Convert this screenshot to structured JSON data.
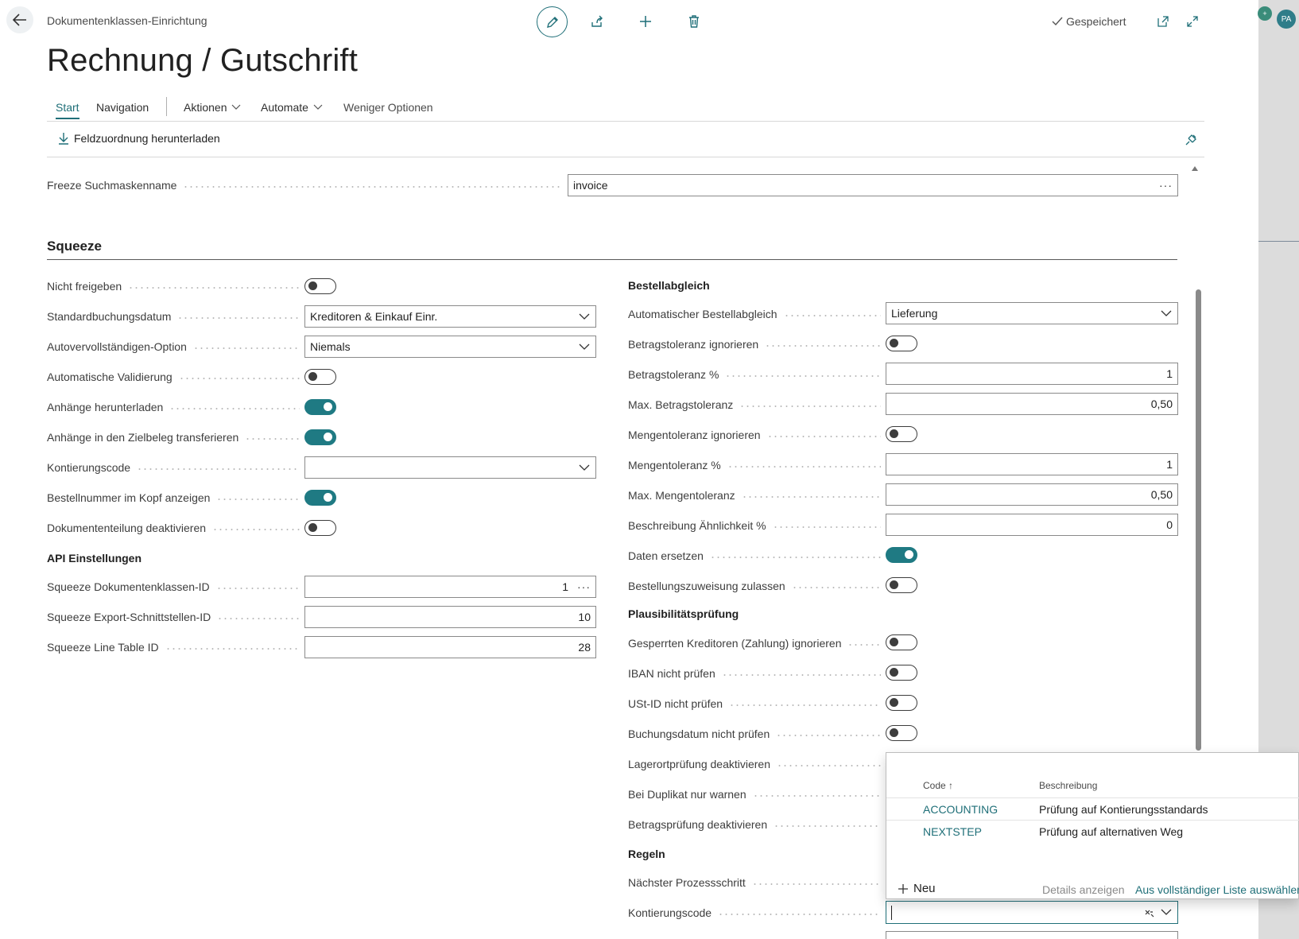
{
  "breadcrumb": "Dokumentenklassen-Einrichtung",
  "title": "Rechnung / Gutschrift",
  "status": {
    "saved": "Gespeichert"
  },
  "user": {
    "initials": "PA"
  },
  "tabs": {
    "start": "Start",
    "navigation": "Navigation",
    "actions": "Aktionen",
    "automate": "Automate",
    "fewer": "Weniger Optionen"
  },
  "promoted": {
    "download": "Feldzuordnung herunterladen"
  },
  "freeze": {
    "label": "Freeze Suchmaskenname",
    "value": "invoice"
  },
  "section": "Squeeze",
  "left": {
    "nicht_freigeben": {
      "label": "Nicht freigeben",
      "on": false
    },
    "standardbuchungsdatum": {
      "label": "Standardbuchungsdatum",
      "value": "Kreditoren & Einkauf Einr."
    },
    "autovervollstaendigen": {
      "label": "Autovervollständigen-Option",
      "value": "Niemals"
    },
    "auto_validierung": {
      "label": "Automatische Validierung",
      "on": false
    },
    "anhaenge_herunterladen": {
      "label": "Anhänge herunterladen",
      "on": true
    },
    "anhaenge_transferieren": {
      "label": "Anhänge in den Zielbeleg transferieren",
      "on": true
    },
    "kontierungscode": {
      "label": "Kontierungscode",
      "value": ""
    },
    "bestellnummer_kopf": {
      "label": "Bestellnummer im Kopf anzeigen",
      "on": true
    },
    "dokumententeilung": {
      "label": "Dokumententeilung deaktivieren",
      "on": false
    },
    "api_title": "API Einstellungen",
    "dokklassen_id": {
      "label": "Squeeze Dokumentenklassen-ID",
      "value": "1"
    },
    "export_id": {
      "label": "Squeeze Export-Schnittstellen-ID",
      "value": "10"
    },
    "line_table_id": {
      "label": "Squeeze Line Table ID",
      "value": "28"
    }
  },
  "right": {
    "bestellabgleich_title": "Bestellabgleich",
    "auto_bestellabgleich": {
      "label": "Automatischer Bestellabgleich",
      "value": "Lieferung"
    },
    "betragstoleranz_ignorieren": {
      "label": "Betragstoleranz ignorieren",
      "on": false
    },
    "betragstoleranz_pct": {
      "label": "Betragstoleranz %",
      "value": "1"
    },
    "max_betragstoleranz": {
      "label": "Max. Betragstoleranz",
      "value": "0,50"
    },
    "mengentoleranz_ignorieren": {
      "label": "Mengentoleranz ignorieren",
      "on": false
    },
    "mengentoleranz_pct": {
      "label": "Mengentoleranz %",
      "value": "1"
    },
    "max_mengentoleranz": {
      "label": "Max. Mengentoleranz",
      "value": "0,50"
    },
    "beschreibung_aehnlichkeit": {
      "label": "Beschreibung Ähnlichkeit %",
      "value": "0"
    },
    "daten_ersetzen": {
      "label": "Daten ersetzen",
      "on": true
    },
    "bestellungszuweisung": {
      "label": "Bestellungszuweisung zulassen",
      "on": false
    },
    "plausi_title": "Plausibilitätsprüfung",
    "gesperrte_kreditoren": {
      "label": "Gesperrten Kreditoren (Zahlung) ignorieren",
      "on": false
    },
    "iban": {
      "label": "IBAN nicht prüfen",
      "on": false
    },
    "ustid": {
      "label": "USt-ID nicht prüfen",
      "on": false
    },
    "buchungsdatum": {
      "label": "Buchungsdatum nicht prüfen",
      "on": false
    },
    "lagerort": {
      "label": "Lagerortprüfung deaktivieren"
    },
    "duplikat": {
      "label": "Bei Duplikat nur warnen"
    },
    "betragspruefung": {
      "label": "Betragsprüfung deaktivieren"
    },
    "regeln_title": "Regeln",
    "naechster_schritt": {
      "label": "Nächster Prozessschritt"
    },
    "kontierungscode": {
      "label": "Kontierungscode",
      "value": ""
    }
  },
  "lookup": {
    "col_code": "Code",
    "col_code_sort": "↑",
    "col_desc": "Beschreibung",
    "rows": [
      {
        "code": "ACCOUNTING",
        "desc": "Prüfung auf Kontierungsstandards"
      },
      {
        "code": "NEXTSTEP",
        "desc": "Prüfung auf alternativen Weg"
      }
    ],
    "new_label": "Neu",
    "details_label": "Details anzeigen",
    "full_list_label": "Aus vollständiger Liste auswählen"
  }
}
